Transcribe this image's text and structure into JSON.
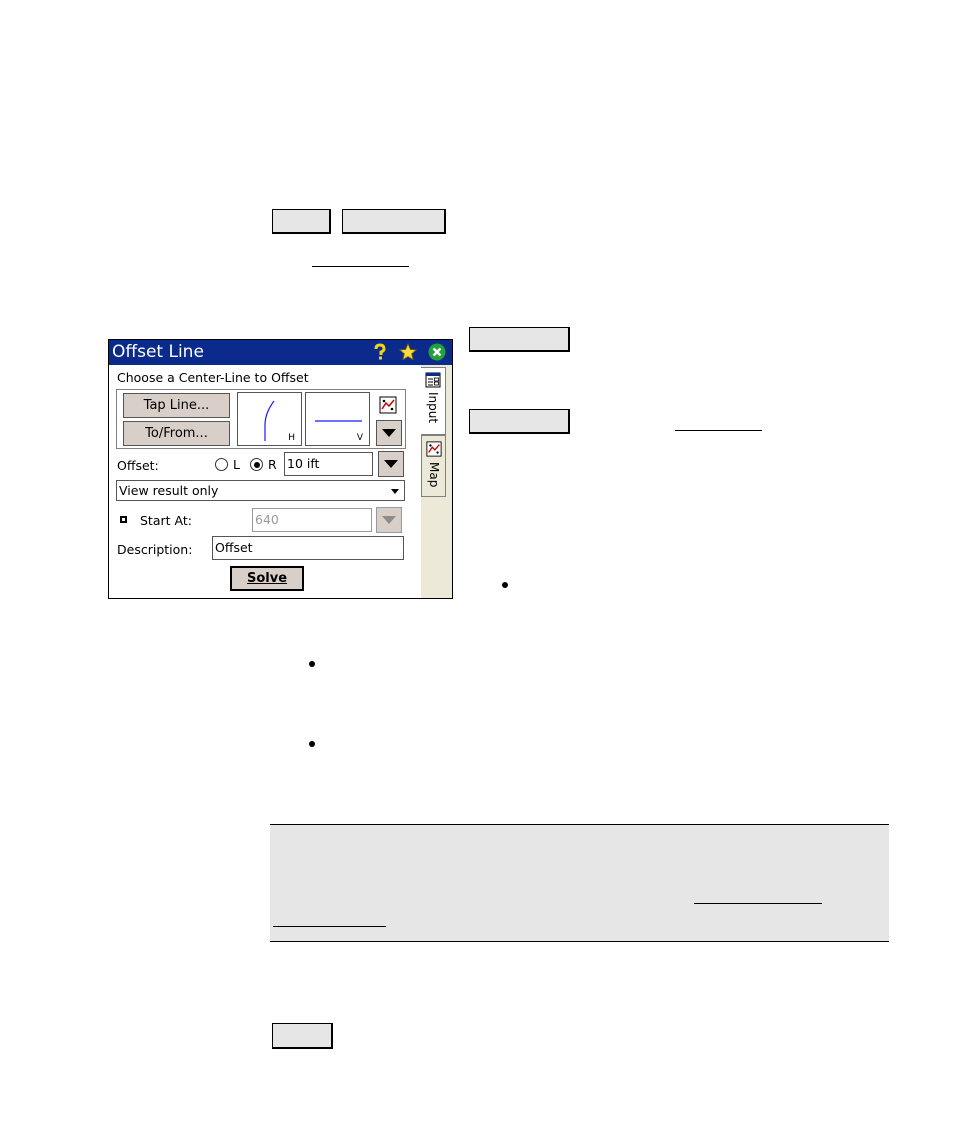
{
  "window": {
    "title": "Offset Line",
    "prompt": "Choose a Center-Line to Offset",
    "tap_line_label": "Tap Line...",
    "to_from_label": "To/From...",
    "h_label": "H",
    "v_label": "V",
    "offset_label": "Offset:",
    "radio_left": "L",
    "radio_right": "R",
    "radio_selected": "R",
    "offset_value": "10 ift",
    "result_mode": "View result only",
    "start_at_label": "Start At:",
    "start_at_value": "640",
    "description_label": "Description:",
    "description_value": "Offset",
    "solve_label": "Solve",
    "tab_input": "Input",
    "tab_map": "Map",
    "title_color": "#0a2a8c",
    "button_color": "#d8cfc8",
    "icons": [
      "help-icon",
      "favorites-icon",
      "close-icon",
      "map-icon",
      "dropdown-arrow-icon"
    ]
  }
}
